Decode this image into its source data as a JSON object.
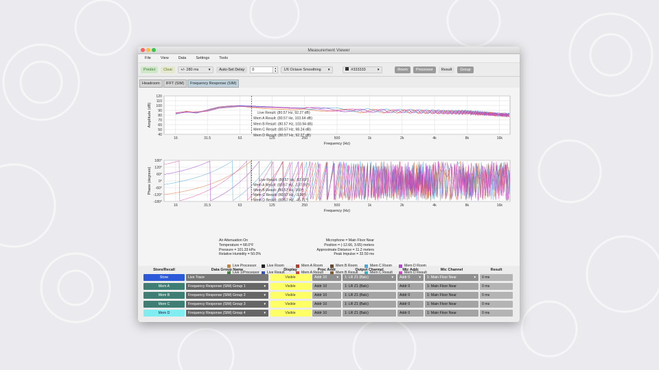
{
  "window": {
    "title": "Measurement Viewer"
  },
  "menu": [
    "File",
    "View",
    "Data",
    "Settings",
    "Tools"
  ],
  "toolbar": {
    "predict": "Predict",
    "clear": "Clear",
    "delay_dropdown": "+/- 280 ms",
    "auto_set_delay": "Auto-Set Delay",
    "delay_value": "0",
    "smoothing": "1/6 Octave Smoothing",
    "color_value": "#333333",
    "view_buttons": [
      "Room",
      "Processor",
      "Result",
      "Group"
    ]
  },
  "tabs": [
    "Headroom",
    "IFFT (SIM)",
    "Frequency Response (SIM)"
  ],
  "amplitude_chart": {
    "ylabel": "Amplitude (dB)",
    "xlabel": "Frequency (Hz)",
    "yticks": [
      "120",
      "110",
      "100",
      "90",
      "80",
      "70",
      "60",
      "50",
      "40"
    ],
    "xticks": [
      "16",
      "31.5",
      "63",
      "125",
      "250",
      "500",
      "1k",
      "2k",
      "4k",
      "8k",
      "16k"
    ],
    "cursor_labels": [
      "Live Result: (80.57 Hz, 92.27 dB)",
      "Mem A Result: (80.57 Hz, 103.64 dB)",
      "Mem B Result: (80.57 Hz, 103.94 dB)",
      "Mem C Result: (80.57 Hz, 98.24 dB)",
      "Mem D Result: (80.57 Hz, 92.27 dB)"
    ]
  },
  "phase_chart": {
    "ylabel": "Phase (degrees)",
    "xlabel": "Frequency (Hz)",
    "yticks": [
      "180°",
      "120°",
      "60°",
      "0°",
      "-60°",
      "-120°",
      "-180°"
    ],
    "xticks": [
      "16",
      "31.5",
      "63",
      "125",
      "250",
      "500",
      "1k",
      "2k",
      "4k",
      "8k",
      "16k"
    ],
    "cursor_labels": [
      "Live Result: (80.57 Hz, -87.83°)",
      "Mem A Result: (80.57 Hz, -137.05°)",
      "Mem B Result: (80.57 Hz, 160°)",
      "Mem C Result: (80.57 Hz, -3.30°)",
      "Mem D Result: (80.57 Hz, -45.71°)"
    ]
  },
  "chart_data": [
    {
      "type": "line",
      "title": "",
      "xlabel": "Frequency (Hz)",
      "ylabel": "Amplitude (dB)",
      "x": [
        16,
        20,
        25,
        31.5,
        40,
        50,
        63,
        80,
        100,
        125,
        160,
        200,
        250,
        315,
        400,
        500,
        630,
        800,
        1000,
        1250,
        1600,
        2000,
        2500,
        3150,
        4000,
        5000,
        6300,
        8000,
        10000,
        12500,
        16000,
        20000
      ],
      "ylim": [
        40,
        120
      ],
      "series": [
        {
          "color": "#e07030",
          "values": [
            84,
            88,
            86,
            90,
            96,
            98,
            99,
            96,
            94,
            93,
            92,
            91,
            93,
            92,
            91,
            90,
            89,
            88,
            89,
            88,
            87,
            88,
            88,
            87,
            87,
            86,
            86,
            86,
            84,
            83,
            81,
            80
          ]
        },
        {
          "color": "#4aa8d8",
          "values": [
            82,
            86,
            85,
            89,
            95,
            97,
            99,
            98,
            97,
            97,
            96,
            95,
            95,
            94,
            93,
            92,
            91,
            90,
            90,
            90,
            89,
            89,
            89,
            88,
            88,
            87,
            87,
            87,
            85,
            84,
            82,
            81
          ]
        },
        {
          "color": "#9a3ac4",
          "values": [
            85,
            87,
            84,
            91,
            97,
            99,
            100,
            99,
            98,
            97,
            96,
            95,
            94,
            93,
            92,
            91,
            90,
            89,
            89,
            89,
            88,
            88,
            88,
            87,
            87,
            86,
            86,
            86,
            84,
            83,
            81,
            80
          ]
        },
        {
          "color": "#d94aa8",
          "values": [
            83,
            86,
            87,
            88,
            94,
            96,
            98,
            97,
            96,
            96,
            95,
            94,
            94,
            93,
            92,
            91,
            90,
            89,
            89,
            88,
            88,
            88,
            87,
            87,
            86,
            86,
            85,
            85,
            83,
            82,
            80,
            79
          ]
        }
      ]
    },
    {
      "type": "line",
      "title": "",
      "xlabel": "Frequency (Hz)",
      "ylabel": "Phase (degrees)",
      "ylim": [
        -180,
        180
      ],
      "series": [
        {
          "color": "#e07030"
        },
        {
          "color": "#4aa8d8"
        },
        {
          "color": "#9a3ac4"
        },
        {
          "color": "#d94aa8"
        }
      ]
    }
  ],
  "legend": [
    {
      "label": "Live Processor",
      "color": "#c8843a"
    },
    {
      "label": "Live Room",
      "color": "#222222"
    },
    {
      "label": "Mem A Room",
      "color": "#c0392b"
    },
    {
      "label": "Mem B Room",
      "color": "#6b4a2a"
    },
    {
      "label": "Mem C Room",
      "color": "#4aa8d8"
    },
    {
      "label": "Mem D Room",
      "color": "#b04ac8"
    },
    {
      "label": "Live 1/Processor",
      "color": "#3a8a3a"
    },
    {
      "label": "Live Result",
      "color": "#2d55c8"
    },
    {
      "label": "Mem A Result",
      "color": "#e0402a"
    },
    {
      "label": "Mem B Result",
      "color": "#8a5a2a"
    },
    {
      "label": "Mem C Result",
      "color": "#2ab8c8"
    },
    {
      "label": "Mem D Result",
      "color": "#d04ad0"
    }
  ],
  "air_info": [
    "Air Attenuation On",
    "Temperature = 68.0°F",
    "Pressure = 101.33  kPa",
    "Relative Humidity = 50.0%"
  ],
  "mic_info": [
    "Microphone = Main Floor Near",
    "Position = (-12.66, 3.65) meters",
    "Approximate Distance = 11.2 meters",
    "Peak Impulse = 32.50 ms"
  ],
  "table": {
    "headers": [
      "Store/Recall",
      "Data Group Name",
      "Display",
      "Proc Addr",
      "Output Channel",
      "Mic Addr",
      "Mic Channel",
      "Result"
    ],
    "rows": [
      {
        "store": "Store",
        "name": "Live Trace",
        "display": "Visible",
        "proc": "Addr 10",
        "output": "1: LR Z1 (Balc)",
        "mic_addr": "Addr 0",
        "mic_channel": "1: Main Floor Near",
        "result": "0 ms"
      },
      {
        "store": "Mem A",
        "name": "Frequency Response (SIM) Group 1",
        "display": "Visible",
        "proc": "Addr 10",
        "output": "1: LR Z1 (Balc)",
        "mic_addr": "Addr 0",
        "mic_channel": "1: Main Floor Near",
        "result": "0 ms"
      },
      {
        "store": "Mem B",
        "name": "Frequency Response (SIM) Group 2",
        "display": "Visible",
        "proc": "Addr 10",
        "output": "1: LR Z1 (Balc)",
        "mic_addr": "Addr 0",
        "mic_channel": "1: Main Floor Near",
        "result": "0 ms"
      },
      {
        "store": "Mem C",
        "name": "Frequency Response (SIM) Group 3",
        "display": "Visible",
        "proc": "Addr 10",
        "output": "1: LR Z1 (Balc)",
        "mic_addr": "Addr 0",
        "mic_channel": "1: Main Floor Near",
        "result": "0 ms"
      },
      {
        "store": "Mem D",
        "name": "Frequency Response (SIM) Group 4",
        "display": "Visible",
        "proc": "Addr 10",
        "output": "1: LR Z1 (Balc)",
        "mic_addr": "Addr 0",
        "mic_channel": "1: Main Floor Near",
        "result": "0 ms"
      }
    ]
  }
}
